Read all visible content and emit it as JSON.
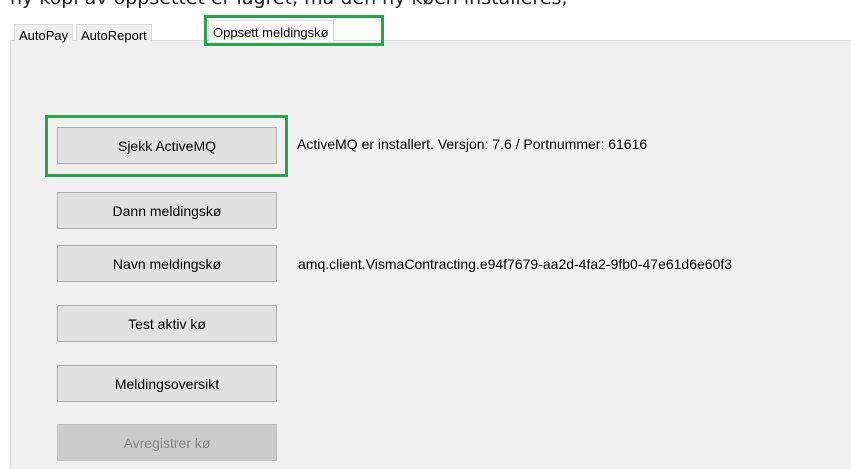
{
  "window": {
    "top_clipped_text": "ny kopi av oppsettet er lagret, må den ny køen installeres,"
  },
  "tabs": [
    {
      "label": "AutoPay",
      "active": false
    },
    {
      "label": "AutoReport",
      "active": false
    },
    {
      "label": "Oppsett meldingskø",
      "active": true
    }
  ],
  "buttons": {
    "check_activemq": "Sjekk ActiveMQ",
    "create_queue": "Dann meldingskø",
    "queue_name": "Navn meldingskø",
    "test_queue": "Test aktiv kø",
    "message_overview": "Meldingsoversikt",
    "unregister_queue": "Avregistrer kø"
  },
  "status": {
    "activemq": "ActiveMQ er installert. Versjon: 7.6 / Portnummer: 61616",
    "queue_name_value": "amq.client.VismaContracting.e94f7679-aa2d-4fa2-9fb0-47e61d6e60f3"
  },
  "colors": {
    "highlight": "#22a648",
    "button_face": "#e1e1e1",
    "disabled_text": "#838383"
  }
}
